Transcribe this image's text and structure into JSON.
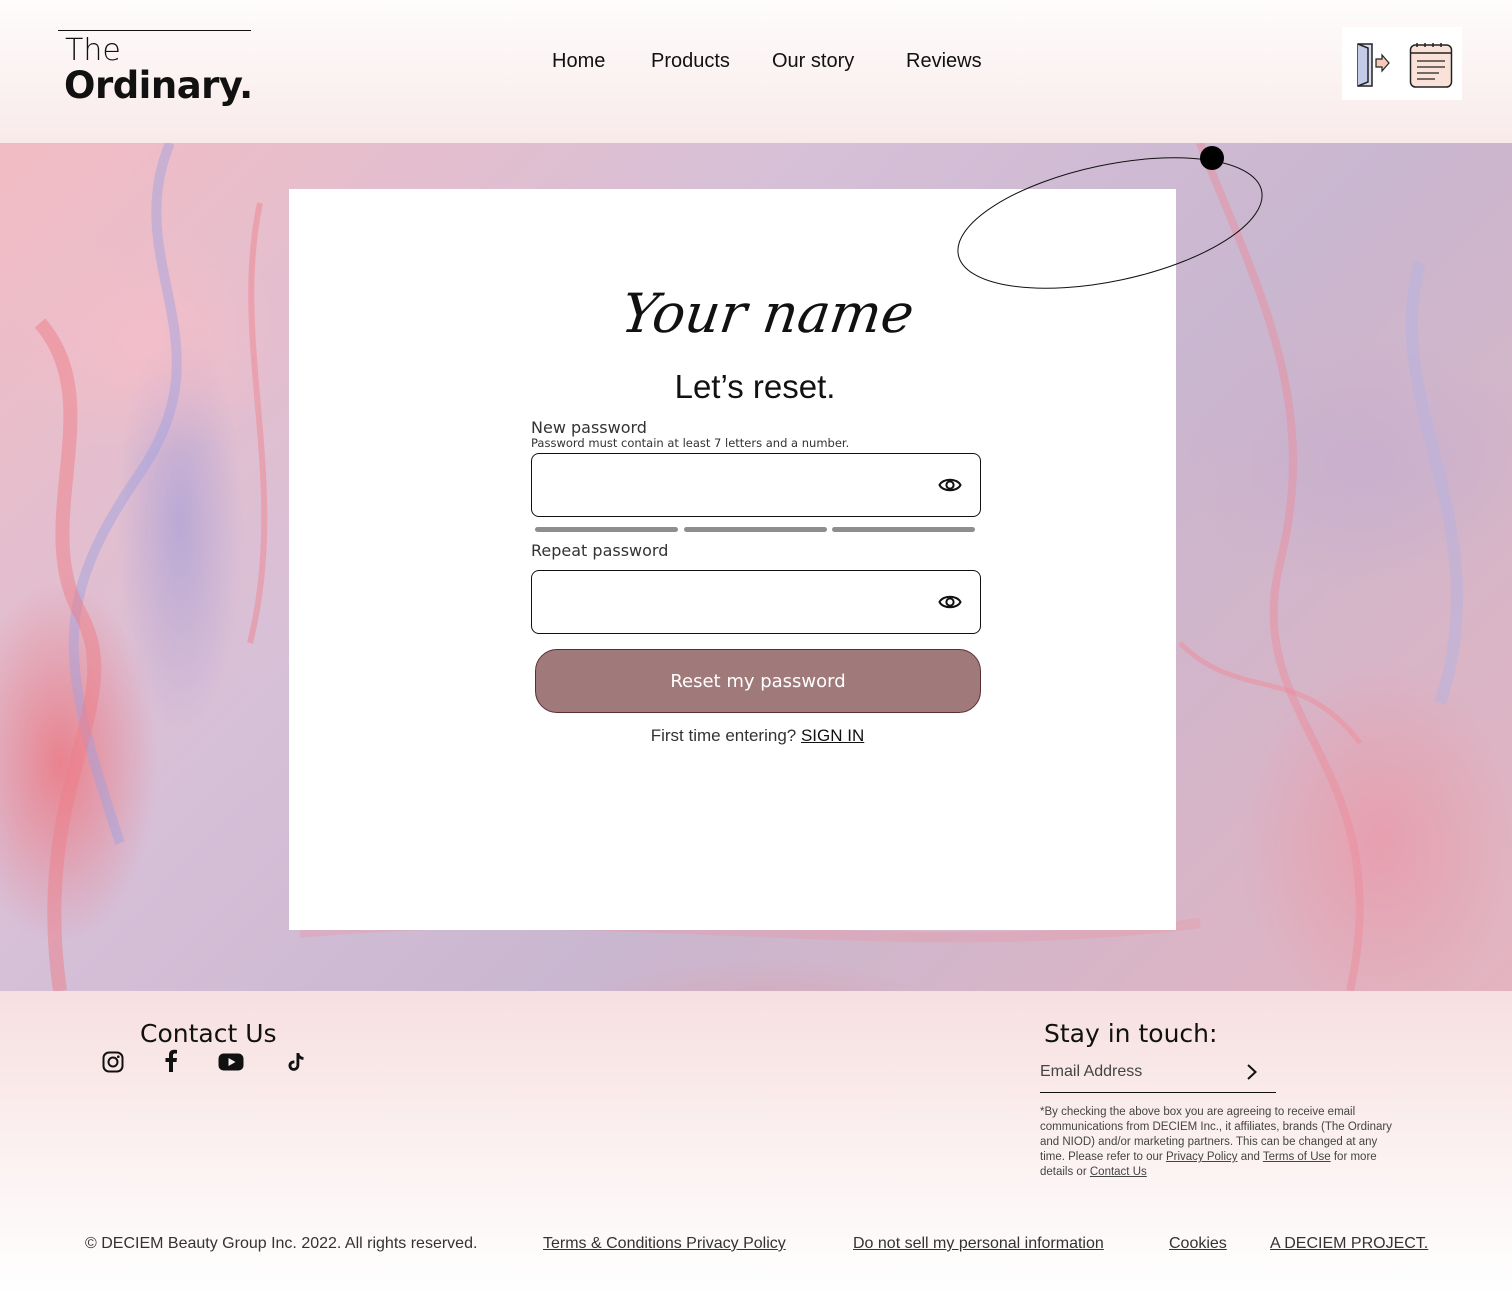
{
  "header": {
    "logo_top": "The",
    "logo_bottom": "Ordinary.",
    "nav": [
      {
        "label": "Home"
      },
      {
        "label": "Products"
      },
      {
        "label": "Our story"
      },
      {
        "label": "Reviews"
      }
    ],
    "icons": [
      "login-door-icon",
      "order-list-icon"
    ]
  },
  "card": {
    "script_title": "Your name",
    "heading": "Let’s reset.",
    "new_password": {
      "label": "New password",
      "hint": "Password must contain at least 7 letters and a number.",
      "value": "",
      "placeholder": ""
    },
    "repeat_password": {
      "label": "Repeat password",
      "value": "",
      "placeholder": ""
    },
    "submit_label": "Reset my password",
    "signin_prompt": "First time entering?",
    "signin_link": "SIGN IN"
  },
  "footer": {
    "contact_title": "Contact Us",
    "social": [
      "instagram-icon",
      "facebook-icon",
      "youtube-icon",
      "tiktok-icon"
    ],
    "stay_title": "Stay in touch:",
    "email_placeholder": "Email Address",
    "consent_text_1": "*By checking the above box you are agreeing to receive email communications from DECIEM Inc., it affiliates, brands (The Ordinary and NIOD) and/or marketing partners. This can be changed at any time. Please refer to our",
    "consent_privacy": "Privacy Policy",
    "consent_and": "and",
    "consent_terms": "Terms of Use",
    "consent_text_2": "for more details or",
    "consent_contact": "Contact Us",
    "copyright": "© DECIEM Beauty Group Inc. 2022. All rights reserved.",
    "links": {
      "terms_privacy": "Terms & Conditions Privacy Policy",
      "do_not_sell": "Do not sell my personal information",
      "cookies": "Cookies",
      "deciem": "A DECIEM PROJECT."
    }
  },
  "colors": {
    "button_fill": "#a07a7a",
    "button_border": "#5a2f34",
    "strength_bar": "#8e8e8e"
  }
}
